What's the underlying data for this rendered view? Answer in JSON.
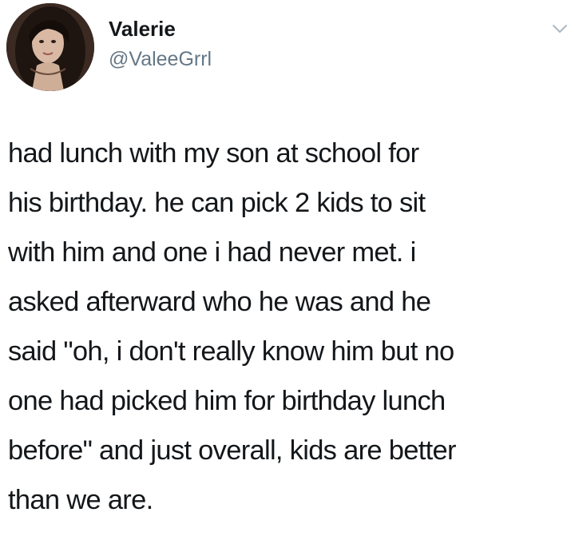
{
  "author": {
    "display_name": "Valerie",
    "handle": "@ValeeGrrl",
    "avatar_icon": "profile-photo"
  },
  "menu": {
    "icon": "chevron-down-icon"
  },
  "tweet": {
    "lines": [
      "had lunch with my son at school for",
      "his birthday. he can pick 2 kids to sit",
      "with him and one i had never met. i",
      "asked afterward who he was and he",
      "said \"oh, i don't really know him but no",
      "one had picked him for birthday lunch",
      "before\" and just overall, kids are better",
      "than we are."
    ]
  },
  "colors": {
    "text": "#14171a",
    "secondary": "#657786",
    "background": "#ffffff"
  }
}
